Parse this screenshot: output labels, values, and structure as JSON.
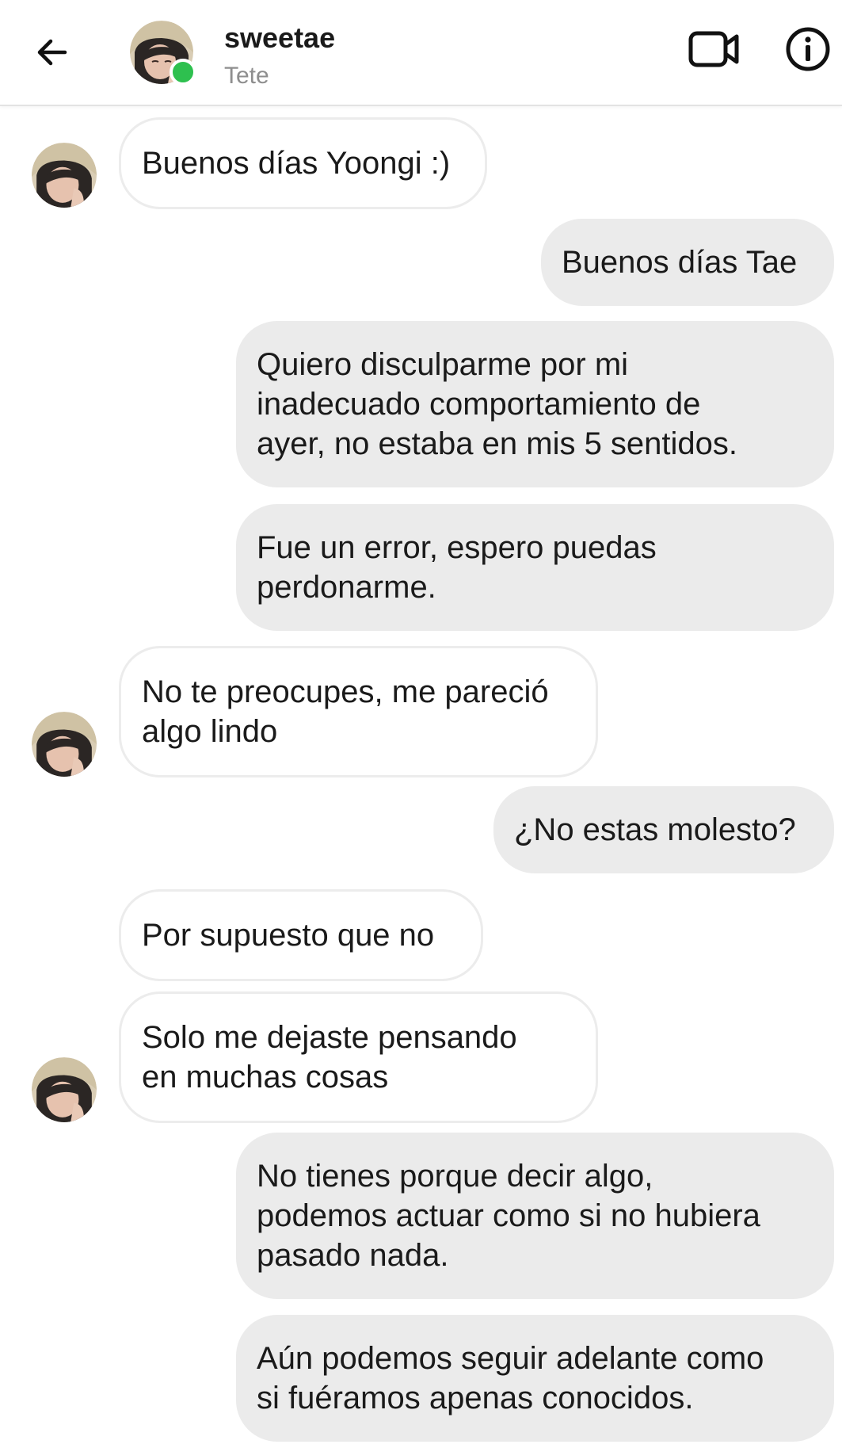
{
  "header": {
    "contact_name": "sweetae",
    "contact_subtitle": "Tete",
    "online_color": "#2ec04f",
    "icons": {
      "back": "arrow-left-icon",
      "video": "video-camera-icon",
      "info": "info-icon"
    }
  },
  "messages": [
    {
      "side": "in",
      "text": "Buenos días Yoongi :)"
    },
    {
      "side": "out",
      "text": "Buenos días Tae"
    },
    {
      "side": "out",
      "text": "Quiero disculparme por mi\ninadecuado comportamiento de\nayer, no estaba en mis 5 sentidos."
    },
    {
      "side": "out",
      "text": "Fue un error, espero puedas\nperdonarme."
    },
    {
      "side": "in",
      "text": "No te preocupes, me pareció\nalgo lindo"
    },
    {
      "side": "out",
      "text": "¿No estas molesto?"
    },
    {
      "side": "in",
      "text": "Por supuesto que no"
    },
    {
      "side": "in",
      "text": "Solo me dejaste pensando\nen muchas cosas"
    },
    {
      "side": "out",
      "text": "No tienes porque decir algo,\npodemos actuar como si no hubiera\npasado nada."
    },
    {
      "side": "out",
      "text": "Aún podemos seguir adelante como\nsi fuéramos apenas conocidos."
    }
  ],
  "colors": {
    "incoming_bubble": "#ffffff",
    "outgoing_bubble": "#ebebeb",
    "text": "#1a1a1a",
    "subtitle": "#8e8e8e"
  }
}
